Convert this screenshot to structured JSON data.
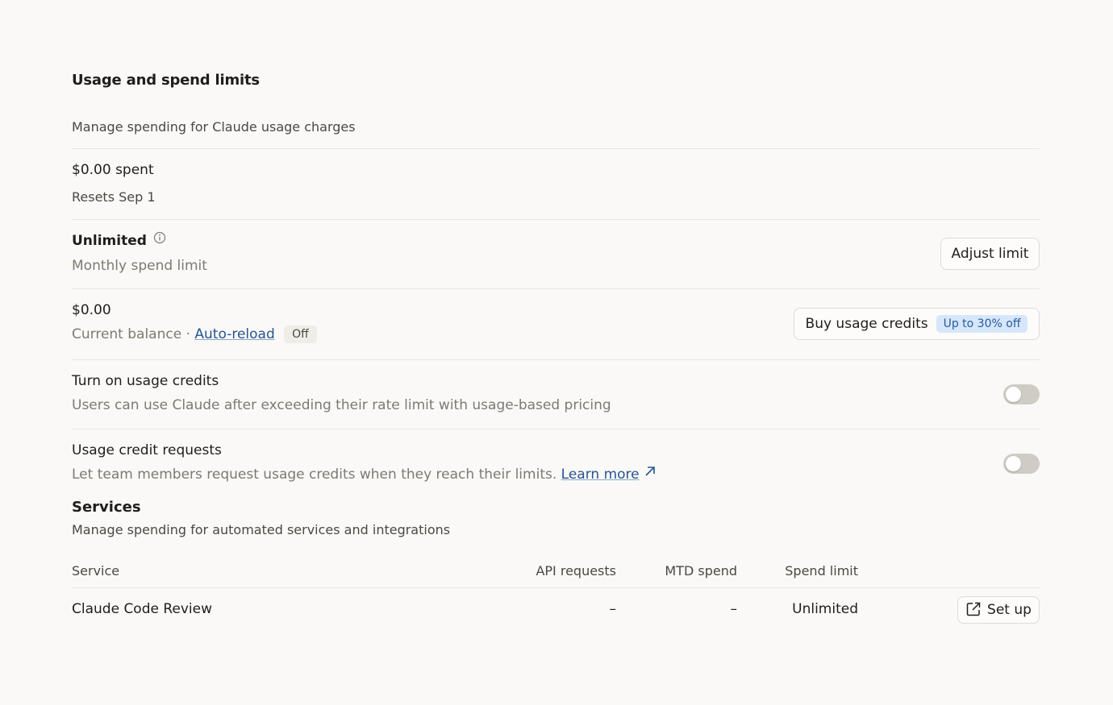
{
  "header": {
    "title": "Usage and spend limits",
    "subtitle": "Manage spending for Claude usage charges"
  },
  "spent": {
    "amount": "$0.00 spent",
    "resets": "Resets Sep 1"
  },
  "limit": {
    "value": "Unlimited",
    "description": "Monthly spend limit",
    "button_label": "Adjust limit",
    "info_icon": "info-icon"
  },
  "balance": {
    "value": "$0.00",
    "description": "Current balance",
    "separator": "·",
    "auto_reload_label": "Auto-reload",
    "auto_reload_status": "Off",
    "buy_button_label": "Buy usage credits",
    "discount_badge": "Up to 30% off"
  },
  "usage_credits": {
    "title": "Turn on usage credits",
    "description": "Users can use Claude after exceeding their rate limit with usage-based pricing",
    "enabled": false
  },
  "credit_requests": {
    "title": "Usage credit requests",
    "description": "Let team members request usage credits when they reach their limits.",
    "learn_more_label": "Learn more",
    "enabled": false
  },
  "services": {
    "title": "Services",
    "subtitle": "Manage spending for automated services and integrations",
    "columns": [
      "Service",
      "API requests",
      "MTD spend",
      "Spend limit"
    ],
    "rows": [
      {
        "service": "Claude Code Review",
        "api_requests": "–",
        "mtd_spend": "–",
        "spend_limit": "Unlimited",
        "action_label": "Set up"
      }
    ]
  },
  "colors": {
    "background": "#faf9f7",
    "link": "#27548f",
    "badge_bg": "#d6e6fb",
    "toggle_off": "#cfccc5"
  }
}
